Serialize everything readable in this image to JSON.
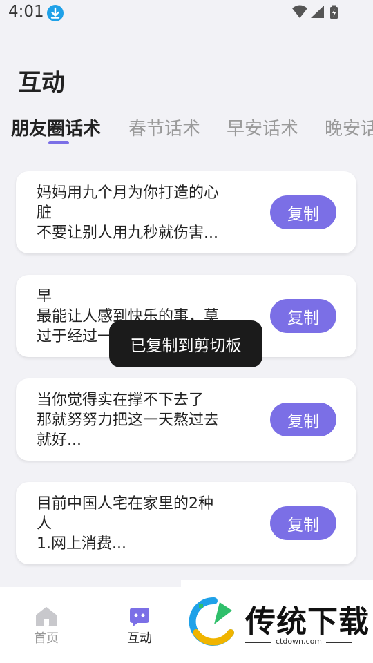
{
  "status_bar": {
    "time": "4:01"
  },
  "page": {
    "title": "互动"
  },
  "tabs": [
    {
      "label": "朋友圈话术",
      "active": true
    },
    {
      "label": "春节话术",
      "active": false
    },
    {
      "label": "早安话术",
      "active": false
    },
    {
      "label": "晚安话术",
      "active": false
    }
  ],
  "cards": [
    {
      "text": "妈妈用九个月为你打造的心\n脏\n不要让别人用九秒就伤害...",
      "button": "复制"
    },
    {
      "text": "早\n最能让人感到快乐的事，莫\n过于经过一番努力后，所...",
      "button": "复制"
    },
    {
      "text": "当你觉得实在撑不下去了\n那就努努力把这一天熬过去\n就好...",
      "button": "复制"
    },
    {
      "text": "目前中国人宅在家里的2种\n人\n1.网上消费...",
      "button": "复制"
    }
  ],
  "toast": {
    "text": "已复制到剪切板"
  },
  "bottom_nav": {
    "items": [
      {
        "label": "首页",
        "icon": "home-icon",
        "active": false
      },
      {
        "label": "互动",
        "icon": "chat-icon",
        "active": true
      }
    ]
  },
  "watermark": {
    "logo_text": "传统下载",
    "url": "ctdown.com"
  },
  "colors": {
    "accent": "#7b6fe6",
    "background": "#f2f2f6",
    "toast_bg": "#1b1b1b",
    "download_icon": "#1fa1e8"
  }
}
